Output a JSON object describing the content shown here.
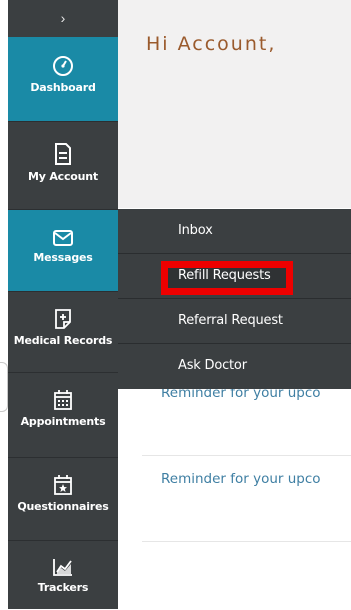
{
  "colors": {
    "sidebar_bg": "#3b3f41",
    "active_bg": "#1a8aa6",
    "greeting_color": "#9a5a2c",
    "reminder_link": "#3f7fa3",
    "highlight": "#ee0000"
  },
  "sidebar": {
    "toggle_icon": "chevron-right-icon",
    "toggle_glyph": "›",
    "items": [
      {
        "label": "Dashboard",
        "icon": "speedometer-icon",
        "active": true
      },
      {
        "label": "My Account",
        "icon": "document-icon",
        "active": false
      },
      {
        "label": "Messages",
        "icon": "envelope-icon",
        "active": true
      },
      {
        "label": "Medical Records",
        "icon": "medical-file-icon",
        "active": false
      },
      {
        "label": "Appointments",
        "icon": "calendar-icon",
        "active": false
      },
      {
        "label": "Questionnaires",
        "icon": "calendar-star-icon",
        "active": false
      },
      {
        "label": "Trackers",
        "icon": "chart-icon",
        "active": false
      }
    ]
  },
  "main": {
    "greeting": "Hi Account,",
    "reminders": [
      {
        "text": "Reminder for your upco"
      },
      {
        "text": "Reminder for your upco"
      }
    ]
  },
  "messages_menu": {
    "items": [
      {
        "label": "Inbox",
        "highlighted": false
      },
      {
        "label": "Refill Requests",
        "highlighted": true
      },
      {
        "label": "Referral Request",
        "highlighted": false
      },
      {
        "label": "Ask Doctor",
        "highlighted": false
      }
    ]
  }
}
